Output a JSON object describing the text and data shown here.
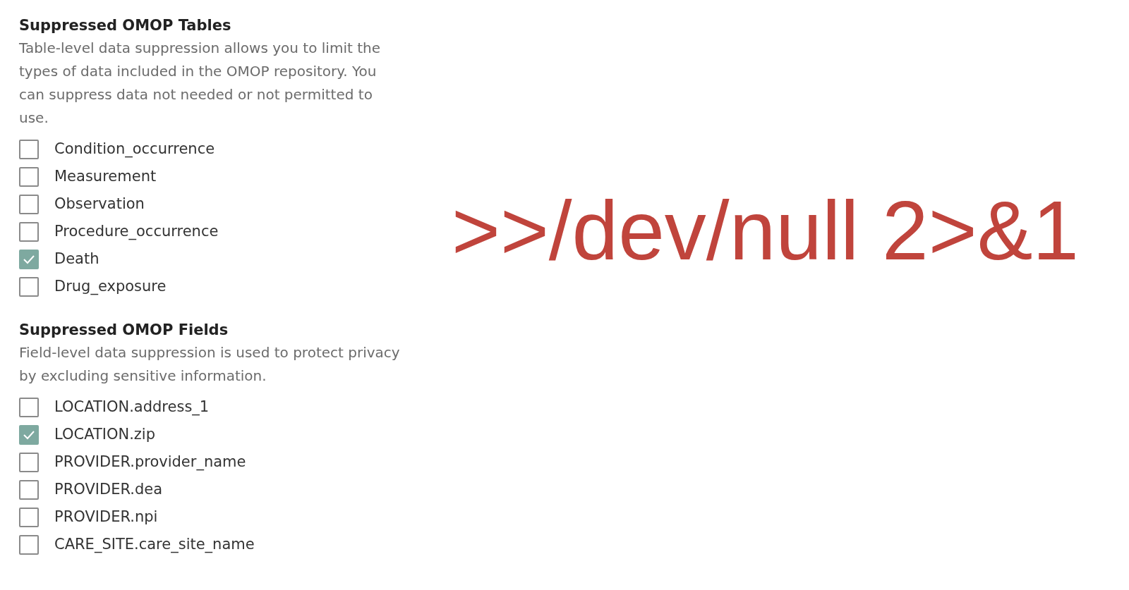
{
  "sections": [
    {
      "title": "Suppressed OMOP Tables",
      "description": "Table-level data suppression allows you to limit the types of data included in the OMOP repository. You can suppress data not needed or not permitted to use.",
      "options": [
        {
          "label": "Condition_occurrence",
          "checked": false
        },
        {
          "label": "Measurement",
          "checked": false
        },
        {
          "label": "Observation",
          "checked": false
        },
        {
          "label": "Procedure_occurrence",
          "checked": false
        },
        {
          "label": "Death",
          "checked": true
        },
        {
          "label": "Drug_exposure",
          "checked": false
        }
      ]
    },
    {
      "title": "Suppressed OMOP Fields",
      "description": "Field-level data suppression is used to protect privacy by excluding sensitive information.",
      "options": [
        {
          "label": "LOCATION.address_1",
          "checked": false
        },
        {
          "label": "LOCATION.zip",
          "checked": true
        },
        {
          "label": "PROVIDER.provider_name",
          "checked": false
        },
        {
          "label": "PROVIDER.dea",
          "checked": false
        },
        {
          "label": "PROVIDER.npi",
          "checked": false
        },
        {
          "label": "CARE_SITE.care_site_name",
          "checked": false
        }
      ]
    }
  ],
  "overlay_text": ">>/dev/null 2>&1"
}
